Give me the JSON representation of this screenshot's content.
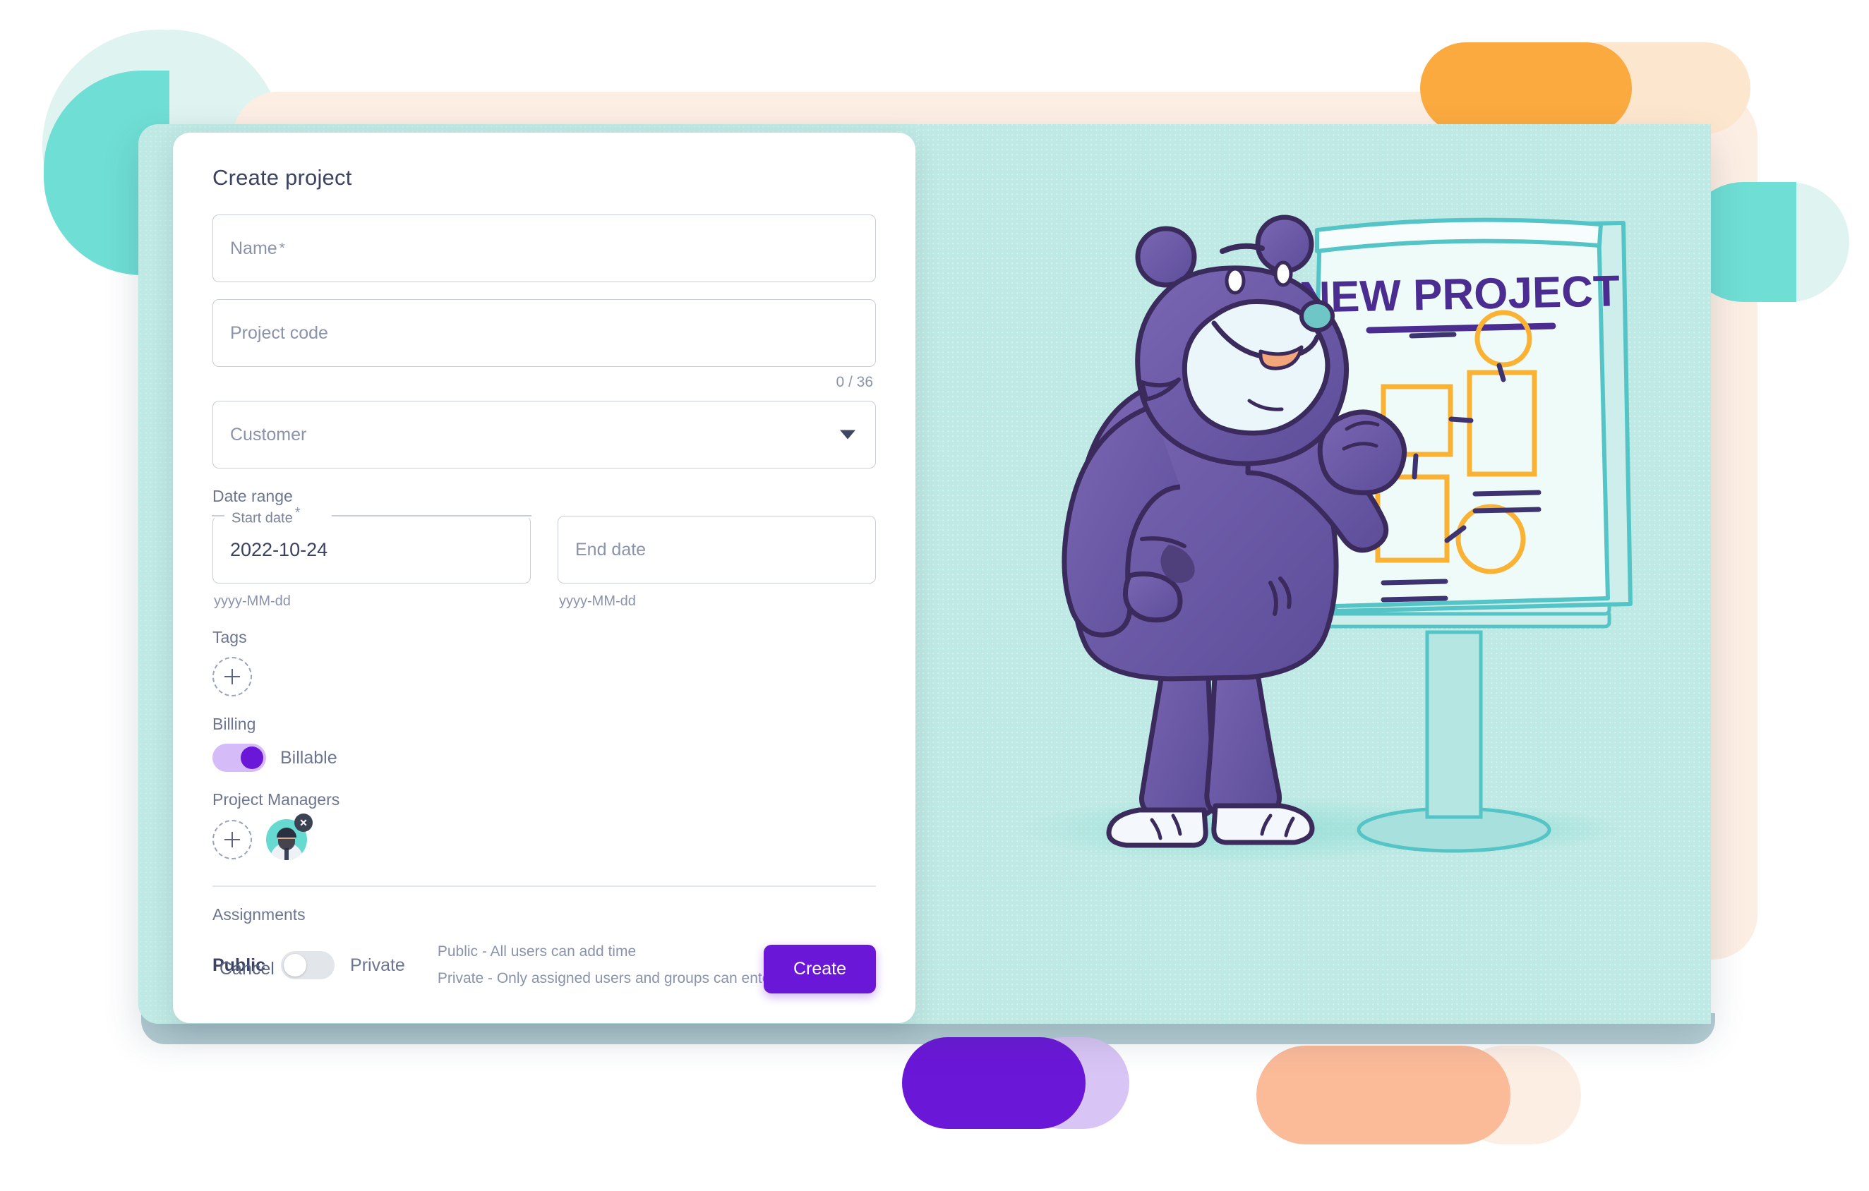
{
  "dialog": {
    "title": "Create project",
    "fields": {
      "name": {
        "label": "Name",
        "required_mark": "*",
        "value": ""
      },
      "project_code": {
        "label": "Project code",
        "value": "",
        "counter": "0 / 36"
      },
      "customer": {
        "label": "Customer",
        "value": "",
        "caret_icon": "chevron-down-icon"
      }
    },
    "date_range": {
      "section_label": "Date range",
      "start": {
        "label": "Start date",
        "required_mark": "*",
        "value": "2022-10-24",
        "hint": "yyyy-MM-dd"
      },
      "end": {
        "label": "End date",
        "value": "",
        "hint": "yyyy-MM-dd"
      }
    },
    "tags": {
      "section_label": "Tags",
      "add_icon": "plus-icon"
    },
    "billing": {
      "section_label": "Billing",
      "toggle_label": "Billable",
      "toggle_state": "on"
    },
    "project_managers": {
      "section_label": "Project Managers",
      "add_icon": "plus-icon",
      "members": [
        {
          "name": "assigned-manager",
          "remove_icon": "close-icon",
          "remove_glyph": "✕"
        }
      ]
    },
    "assignments": {
      "section_label": "Assignments",
      "left_label": "Public",
      "right_label": "Private",
      "toggle_state": "off",
      "descriptions": [
        "Public - All users can add time",
        "Private - Only assigned users and groups can enter time"
      ]
    },
    "footer": {
      "cancel_label": "Cancel",
      "create_label": "Create"
    }
  },
  "illustration": {
    "board_title": "NEW PROJECT",
    "character": "bear-mascot",
    "easel": "flipchart-easel"
  },
  "colors": {
    "accent_purple": "#6b17d8",
    "panel_teal": "#bfe9e4",
    "blob_teal": "#6fded4",
    "blob_pale_teal": "#dff3f0",
    "blob_orange": "#fbaa3f",
    "blob_peach": "#fdeee4",
    "blob_salmon": "#fbbb99",
    "toggle_on_track": "#d5bbf8",
    "text_dark": "#3b4262",
    "text_muted": "#8a93ab",
    "border": "#c7cddb",
    "board_yellow": "#f9b233",
    "bear_purple": "#6e5aa8"
  }
}
